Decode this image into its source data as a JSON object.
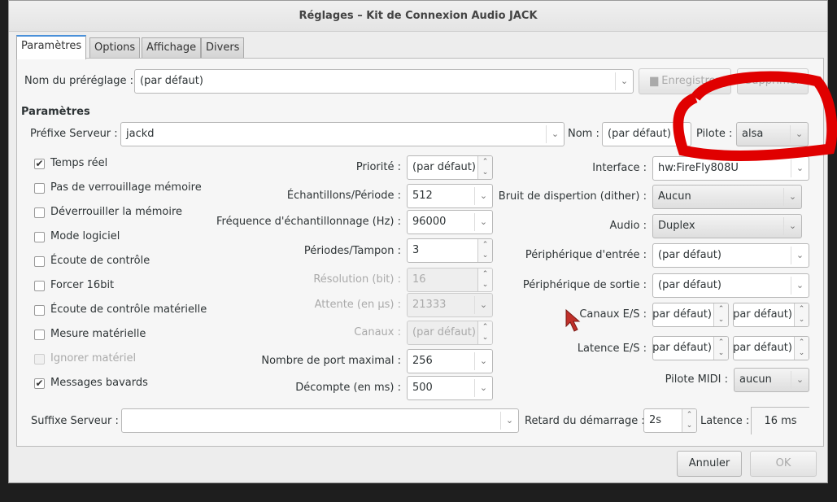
{
  "window": {
    "title": "Réglages – Kit de Connexion Audio JACK"
  },
  "tabs": [
    {
      "label": "Paramètres"
    },
    {
      "label": "Options"
    },
    {
      "label": "Affichage"
    },
    {
      "label": "Divers"
    }
  ],
  "preset": {
    "label": "Nom du préréglage :",
    "value": "(par défaut)",
    "save_label": "Enregistrer",
    "delete_label": "Supprimer"
  },
  "section_title": "Paramètres",
  "server": {
    "prefix_label": "Préfixe Serveur :",
    "prefix_value": "jackd",
    "name_label": "Nom :",
    "name_value": "(par défaut)",
    "driver_label": "Pilote :",
    "driver_value": "alsa"
  },
  "checkboxes": [
    {
      "label": "Temps réel",
      "checked": true
    },
    {
      "label": "Pas de verrouillage mémoire",
      "checked": false
    },
    {
      "label": "Déverrouiller la mémoire",
      "checked": false
    },
    {
      "label": "Mode logiciel",
      "checked": false
    },
    {
      "label": "Écoute de contrôle",
      "checked": false
    },
    {
      "label": "Forcer 16bit",
      "checked": false
    },
    {
      "label": "Écoute de contrôle matérielle",
      "checked": false
    },
    {
      "label": "Mesure matérielle",
      "checked": false
    },
    {
      "label": "Ignorer matériel",
      "checked": false,
      "disabled": true
    },
    {
      "label": "Messages bavards",
      "checked": true
    }
  ],
  "mid": [
    {
      "label": "Priorité :",
      "value": "(par défaut)"
    },
    {
      "label": "Échantillons/Période :",
      "value": "512"
    },
    {
      "label": "Fréquence d'échantillonnage (Hz) :",
      "value": "96000"
    },
    {
      "label": "Périodes/Tampon :",
      "value": "3"
    },
    {
      "label": "Résolution (bit) :",
      "value": "16"
    },
    {
      "label": "Attente (en µs) :",
      "value": "21333"
    },
    {
      "label": "Canaux :",
      "value": "(par défaut)"
    },
    {
      "label": "Nombre de port maximal :",
      "value": "256"
    },
    {
      "label": "Décompte (en ms) :",
      "value": "500"
    }
  ],
  "right": {
    "interface_label": "Interface :",
    "interface_value": "hw:FireFly808U",
    "dither_label": "Bruit de dispertion (dither) :",
    "dither_value": "Aucun",
    "audio_label": "Audio :",
    "audio_value": "Duplex",
    "input_label": "Périphérique d'entrée :",
    "input_value": "(par défaut)",
    "output_label": "Périphérique de sortie :",
    "output_value": "(par défaut)",
    "channels_label": "Canaux E/S :",
    "channels_in": "(par défaut)",
    "channels_out": "(par défaut)",
    "latency_label": "Latence E/S :",
    "latency_in": "(par défaut)",
    "latency_out": "(par défaut)",
    "midi_label": "Pilote MIDI :",
    "midi_value": "aucun"
  },
  "bottom": {
    "suffix_label": "Suffixe Serveur :",
    "suffix_value": "",
    "delay_label": "Retard du démarrage :",
    "delay_value": "2s",
    "latency_label": "Latence :",
    "latency_value": "16 ms"
  },
  "buttons": {
    "cancel": "Annuler",
    "ok": "OK"
  },
  "annotation_color": "#e00000"
}
